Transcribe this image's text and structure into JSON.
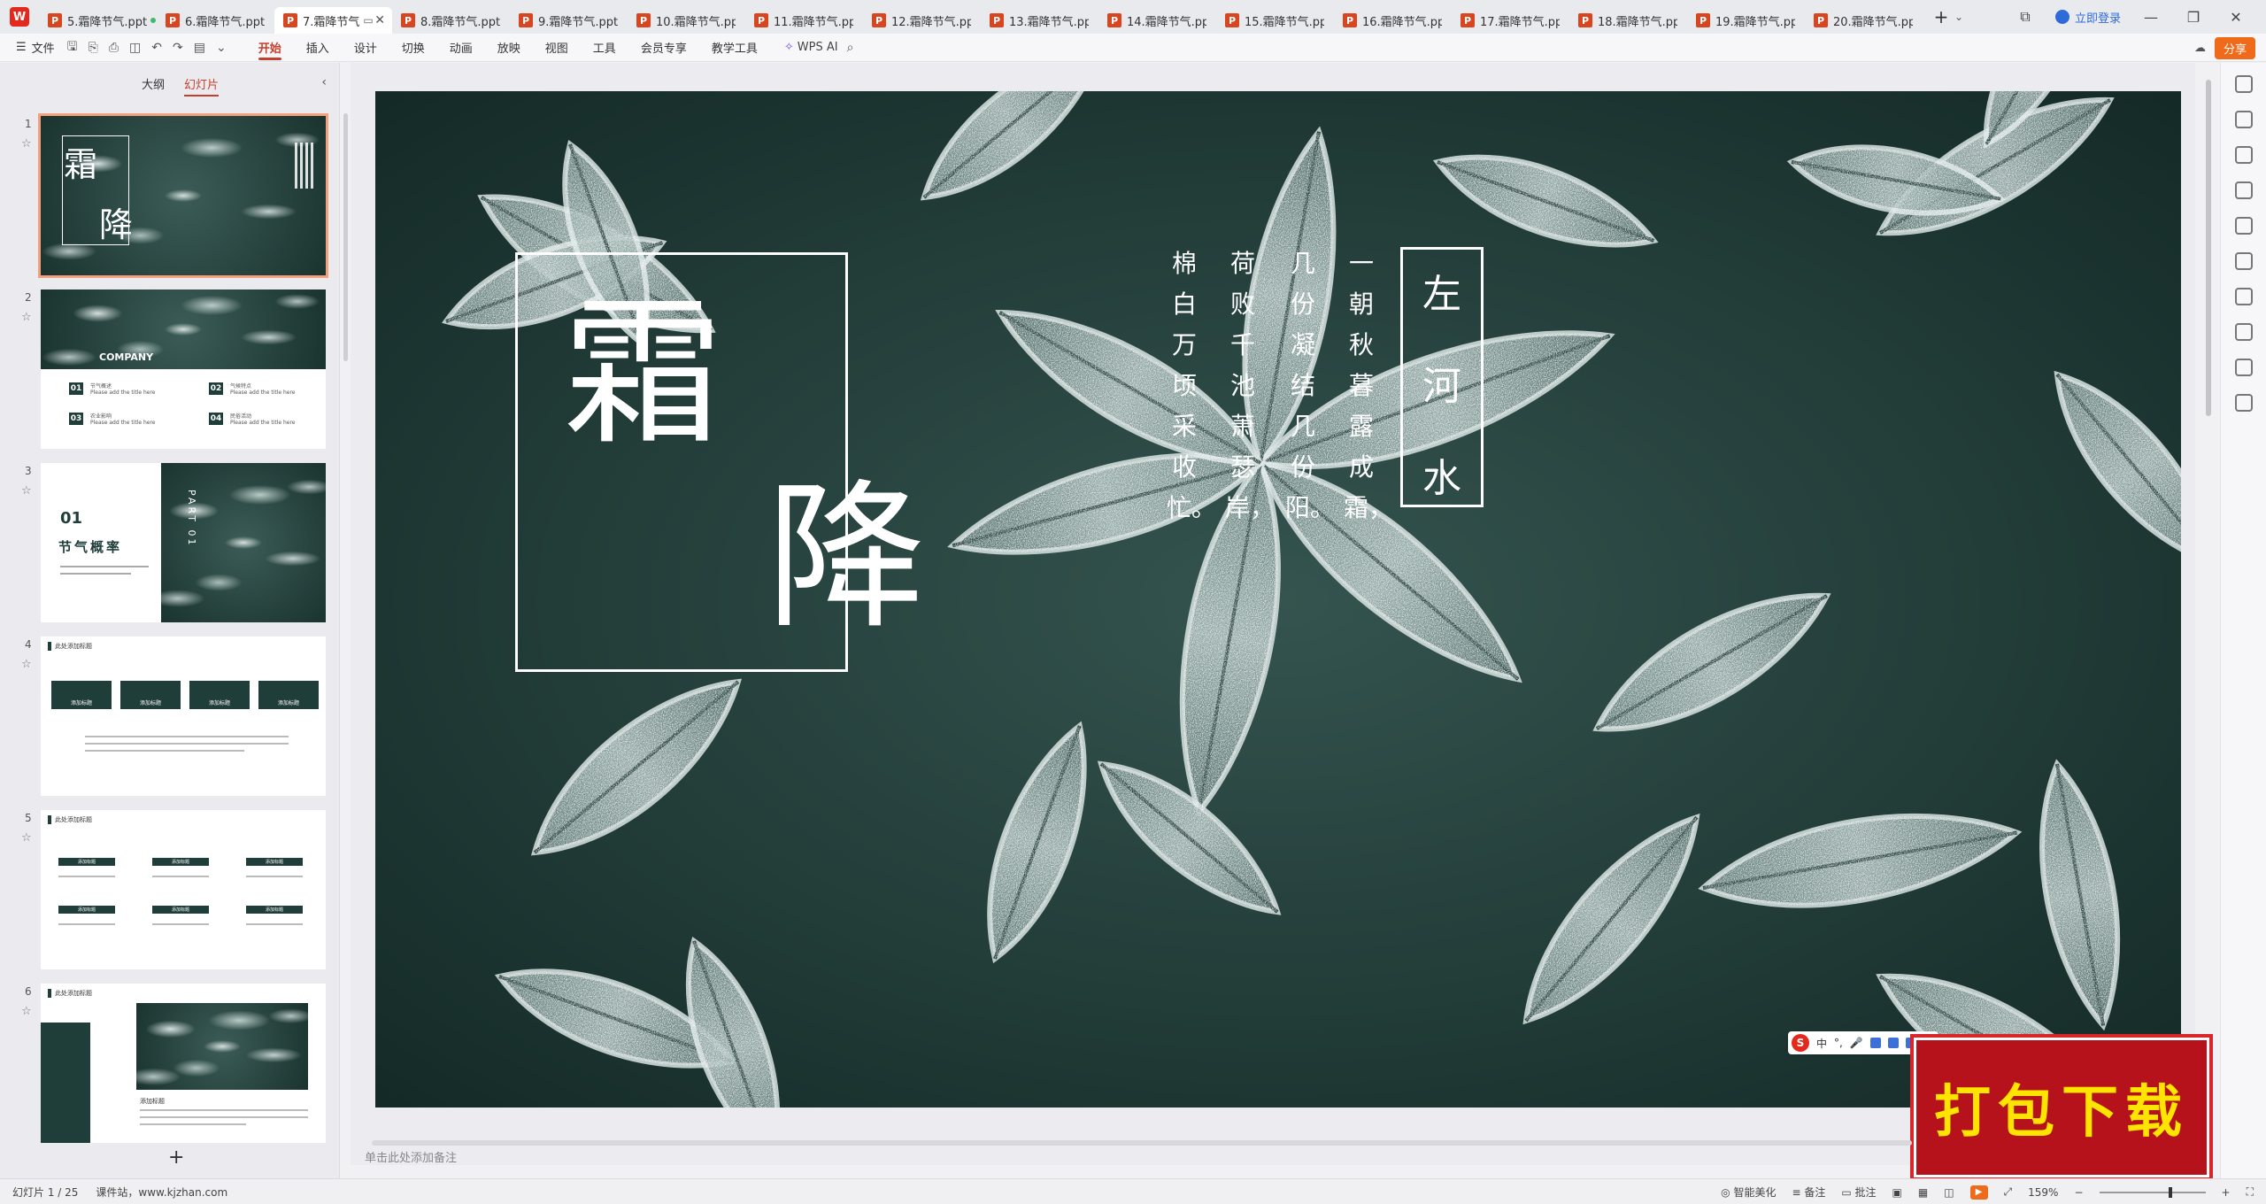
{
  "tabs": [
    {
      "label": "5.霜降节气.ppt",
      "active": false,
      "dot": true
    },
    {
      "label": "6.霜降节气.pptx",
      "active": false
    },
    {
      "label": "7.霜降节气",
      "active": true
    },
    {
      "label": "8.霜降节气.pptx",
      "active": false
    },
    {
      "label": "9.霜降节气.pptx",
      "active": false
    },
    {
      "label": "10.霜降节气.ppt",
      "active": false
    },
    {
      "label": "11.霜降节气.ppt",
      "active": false
    },
    {
      "label": "12.霜降节气.ppt",
      "active": false
    },
    {
      "label": "13.霜降节气.ppt",
      "active": false
    },
    {
      "label": "14.霜降节气.ppt",
      "active": false
    },
    {
      "label": "15.霜降节气.ppt",
      "active": false
    },
    {
      "label": "16.霜降节气.ppt",
      "active": false
    },
    {
      "label": "17.霜降节气.ppt",
      "active": false
    },
    {
      "label": "18.霜降节气.ppt",
      "active": false
    },
    {
      "label": "19.霜降节气.ppt",
      "active": false
    },
    {
      "label": "20.霜降节气.ppt",
      "active": false
    }
  ],
  "titlebar": {
    "login": "立即登录"
  },
  "ribbon": {
    "file": "文件",
    "tabs": [
      "开始",
      "插入",
      "设计",
      "切换",
      "动画",
      "放映",
      "视图",
      "工具",
      "会员专享",
      "教学工具"
    ],
    "active_tab": "开始",
    "wps_ai": "WPS AI",
    "share": "分享"
  },
  "left_panel": {
    "tab_outline": "大纲",
    "tab_slides": "幻灯片",
    "slides": [
      {
        "num": "1",
        "t1": "霜",
        "t2": "降"
      },
      {
        "num": "2",
        "company": "COMPANY",
        "items": [
          {
            "n": "01",
            "title": "节气概述",
            "sub": "Please add the title here"
          },
          {
            "n": "02",
            "title": "气候特点",
            "sub": "Please add the title here"
          },
          {
            "n": "03",
            "title": "农业影响",
            "sub": "Please add the title here"
          },
          {
            "n": "04",
            "title": "民俗活动",
            "sub": "Please add the title here"
          }
        ]
      },
      {
        "num": "3",
        "part_num": "01",
        "title": "节气概率",
        "part": "PART 01"
      },
      {
        "num": "4",
        "header": "此处添加标题",
        "boxes": [
          "添加标题",
          "添加标题",
          "添加标题",
          "添加标题"
        ]
      },
      {
        "num": "5",
        "header": "此处添加标题",
        "boxes": [
          "添加标题",
          "添加标题",
          "添加标题",
          "添加标题",
          "添加标题",
          "添加标题"
        ]
      },
      {
        "num": "6",
        "header": "此处添加标题",
        "subtitle": "添加标题"
      }
    ],
    "add": "+"
  },
  "slide": {
    "title_char_1": "霜",
    "title_char_2": "降",
    "poem_columns": [
      "一朝秋暮露成霜，",
      "几份凝结几份阳。",
      "荷败千池萧瑟岸，",
      "棉白万顷采收忙。"
    ],
    "author": [
      "左",
      "河",
      "水"
    ]
  },
  "ime": {
    "lang": "中"
  },
  "download_badge": "打包下载",
  "notes_placeholder": "单击此处添加备注",
  "status": {
    "slide_info": "幻灯片 1 / 25",
    "site": "课件站，www.kjzhan.com",
    "beautify": "智能美化",
    "notes": "备注",
    "comments": "批注",
    "zoom": "159%"
  },
  "colors": {
    "accent": "#c4402c",
    "dark_green": "#1f3d39",
    "badge_red": "#b5121b",
    "badge_yellow": "#ffe400"
  }
}
